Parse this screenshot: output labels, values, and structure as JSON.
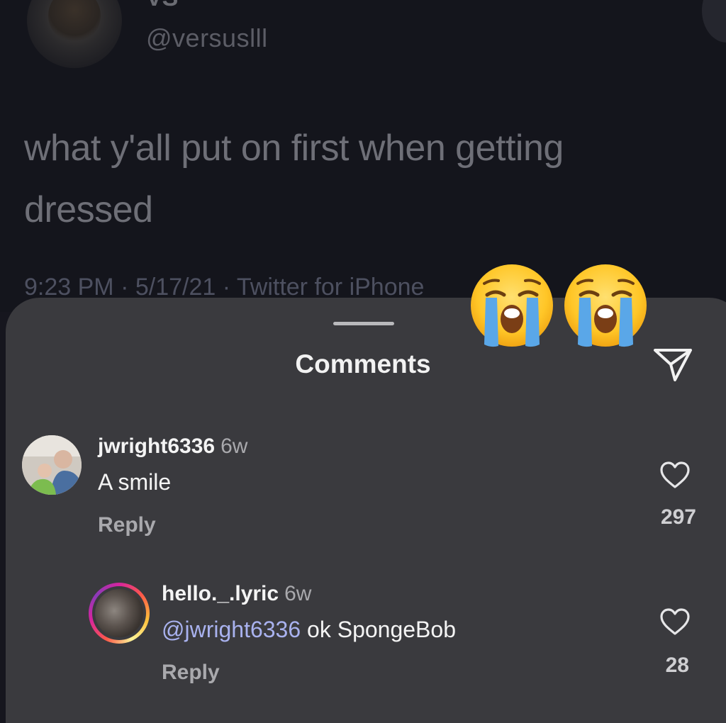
{
  "tweet": {
    "display_name": "VS",
    "handle": "@versuslll",
    "text": "what y'all put on first when getting dressed",
    "meta": "9:23 PM · 5/17/21 · Twitter for iPhone"
  },
  "comments_sheet": {
    "title": "Comments",
    "comments": [
      {
        "username": "jwright6336",
        "age": "6w",
        "mention": "",
        "text": "A smile",
        "reply_label": "Reply",
        "likes": "297"
      },
      {
        "username": "hello._.lyric",
        "age": "6w",
        "mention": "@jwright6336",
        "text": "ok SpongeBob",
        "reply_label": "Reply",
        "likes": "28"
      }
    ]
  },
  "icons": {
    "share": "paper-plane-icon",
    "like": "heart-icon",
    "emoji": "loudly-crying-face-emoji"
  },
  "colors": {
    "sheet_bg": "#3a3a3e",
    "mention": "#a9b2ef",
    "secondary_text": "#a9a9ad"
  }
}
